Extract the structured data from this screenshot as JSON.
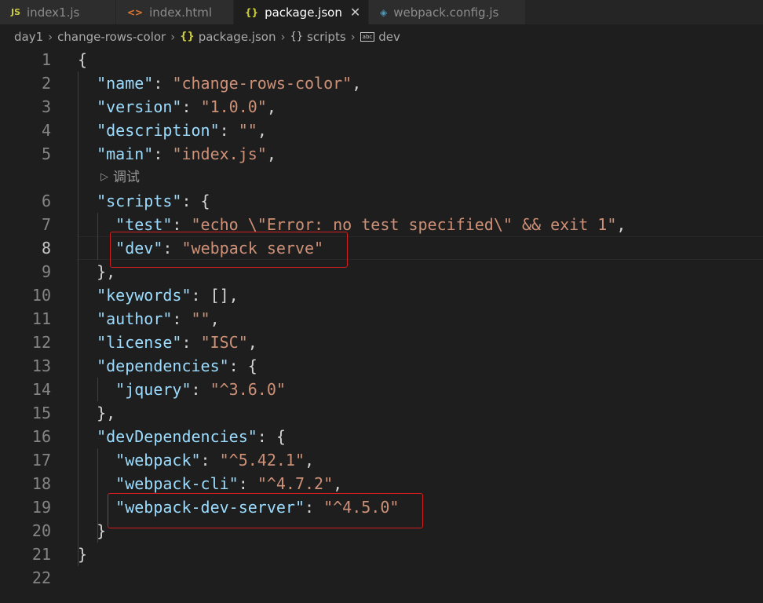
{
  "tabs": [
    {
      "icon": "JS",
      "label": "index1.js",
      "active": false
    },
    {
      "icon": "<>",
      "label": "index.html",
      "active": false
    },
    {
      "icon": "{}",
      "label": "package.json",
      "active": true,
      "close": "✕"
    },
    {
      "icon": "◈",
      "label": "webpack.config.js",
      "active": false
    }
  ],
  "breadcrumb": {
    "items": [
      "day1",
      "change-rows-color",
      "package.json",
      "scripts",
      "dev"
    ],
    "icons": {
      "json": "{}",
      "obj": "{}",
      "str": "abc"
    }
  },
  "codelens": {
    "icon": "▷",
    "label": "调试"
  },
  "current_line": 8,
  "highlights": [
    "\"dev\": \"webpack serve\"",
    "\"webpack-dev-server\": \"^4.5.0\""
  ],
  "lines": [
    {
      "n": "1",
      "t": "{"
    },
    {
      "n": "2",
      "t": "  \"name\": \"change-rows-color\","
    },
    {
      "n": "3",
      "t": "  \"version\": \"1.0.0\","
    },
    {
      "n": "4",
      "t": "  \"description\": \"\","
    },
    {
      "n": "5",
      "t": "  \"main\": \"index.js\","
    },
    {
      "n": "6",
      "t": "  \"scripts\": {"
    },
    {
      "n": "7",
      "t": "    \"test\": \"echo \\\"Error: no test specified\\\" && exit 1\","
    },
    {
      "n": "8",
      "t": "    \"dev\": \"webpack serve\""
    },
    {
      "n": "9",
      "t": "  },"
    },
    {
      "n": "10",
      "t": "  \"keywords\": [],"
    },
    {
      "n": "11",
      "t": "  \"author\": \"\","
    },
    {
      "n": "12",
      "t": "  \"license\": \"ISC\","
    },
    {
      "n": "13",
      "t": "  \"dependencies\": {"
    },
    {
      "n": "14",
      "t": "    \"jquery\": \"^3.6.0\""
    },
    {
      "n": "15",
      "t": "  },"
    },
    {
      "n": "16",
      "t": "  \"devDependencies\": {"
    },
    {
      "n": "17",
      "t": "    \"webpack\": \"^5.42.1\","
    },
    {
      "n": "18",
      "t": "    \"webpack-cli\": \"^4.7.2\","
    },
    {
      "n": "19",
      "t": "    \"webpack-dev-server\": \"^4.5.0\""
    },
    {
      "n": "20",
      "t": "  }"
    },
    {
      "n": "21",
      "t": "}"
    },
    {
      "n": "22",
      "t": ""
    }
  ],
  "colors": {
    "key": "#9cdcfe",
    "string": "#ce9178",
    "punct": "#d4d4d4",
    "highlight_box": "#d21f1f"
  }
}
